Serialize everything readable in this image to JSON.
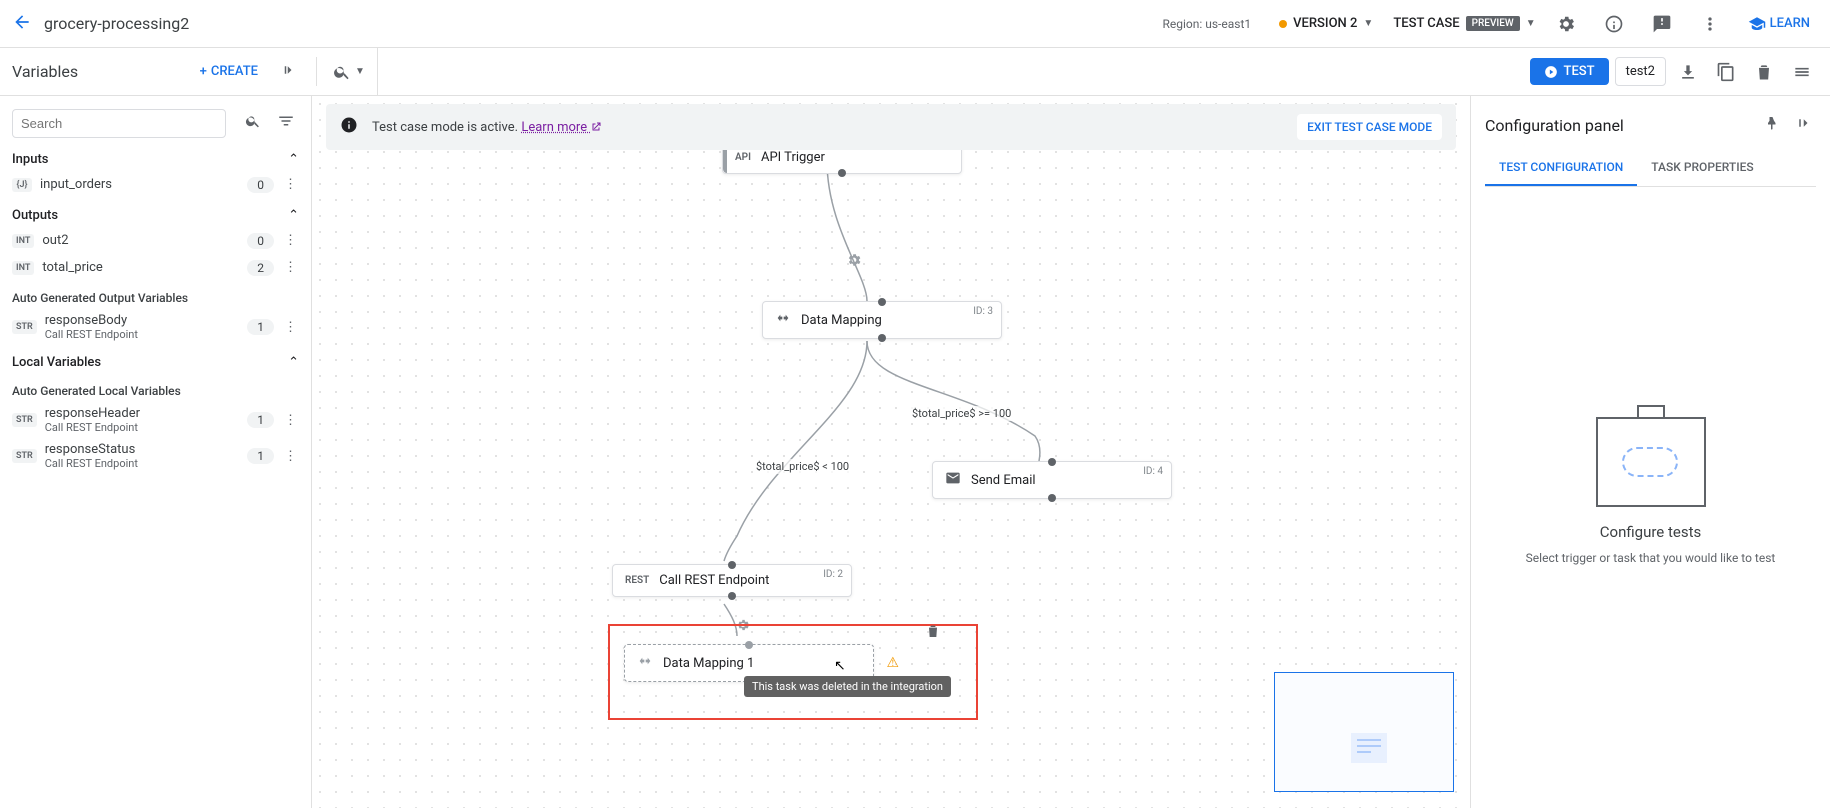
{
  "topbar": {
    "title": "grocery-processing2",
    "region": "Region: us-east1",
    "version": "VERSION 2",
    "testcase": "TEST CASE",
    "preview": "PREVIEW",
    "learn": "LEARN"
  },
  "toolbar": {
    "variables_title": "Variables",
    "create": "CREATE",
    "test": "TEST",
    "test_name": "test2"
  },
  "info_bar": {
    "msg": "Test case mode is active. ",
    "link": "Learn more",
    "exit": "EXIT TEST CASE MODE"
  },
  "search": {
    "placeholder": "Search"
  },
  "sections": {
    "inputs": "Inputs",
    "outputs": "Outputs",
    "auto_out": "Auto Generated Output Variables",
    "local": "Local Variables",
    "auto_local": "Auto Generated Local Variables"
  },
  "vars": {
    "inputs": [
      {
        "type": "{J}",
        "name": "input_orders",
        "count": "0"
      }
    ],
    "outputs": [
      {
        "type": "INT",
        "name": "out2",
        "count": "0"
      },
      {
        "type": "INT",
        "name": "total_price",
        "count": "2"
      }
    ],
    "auto_out": [
      {
        "type": "STR",
        "name": "responseBody",
        "sub": "Call REST Endpoint",
        "count": "1"
      }
    ],
    "auto_local": [
      {
        "type": "STR",
        "name": "responseHeader",
        "sub": "Call REST Endpoint",
        "count": "1"
      },
      {
        "type": "STR",
        "name": "responseStatus",
        "sub": "Call REST Endpoint",
        "count": "1"
      }
    ]
  },
  "nodes": {
    "api_trigger": {
      "icon": "API",
      "label": "API Trigger"
    },
    "data_mapping": {
      "label": "Data Mapping",
      "id": "ID: 3"
    },
    "send_email": {
      "label": "Send Email",
      "id": "ID: 4"
    },
    "call_rest": {
      "icon": "REST",
      "label": "Call REST Endpoint",
      "id": "ID: 2"
    },
    "data_mapping_1": {
      "label": "Data Mapping 1"
    }
  },
  "edges": {
    "cond_lt": "$total_price$ < 100",
    "cond_ge": "$total_price$ >= 100"
  },
  "tooltip": "This task was deleted in the integration",
  "config": {
    "title": "Configuration panel",
    "tab1": "TEST CONFIGURATION",
    "tab2": "TASK PROPERTIES",
    "empty_title": "Configure tests",
    "empty_sub": "Select trigger or task that you would like to test"
  }
}
